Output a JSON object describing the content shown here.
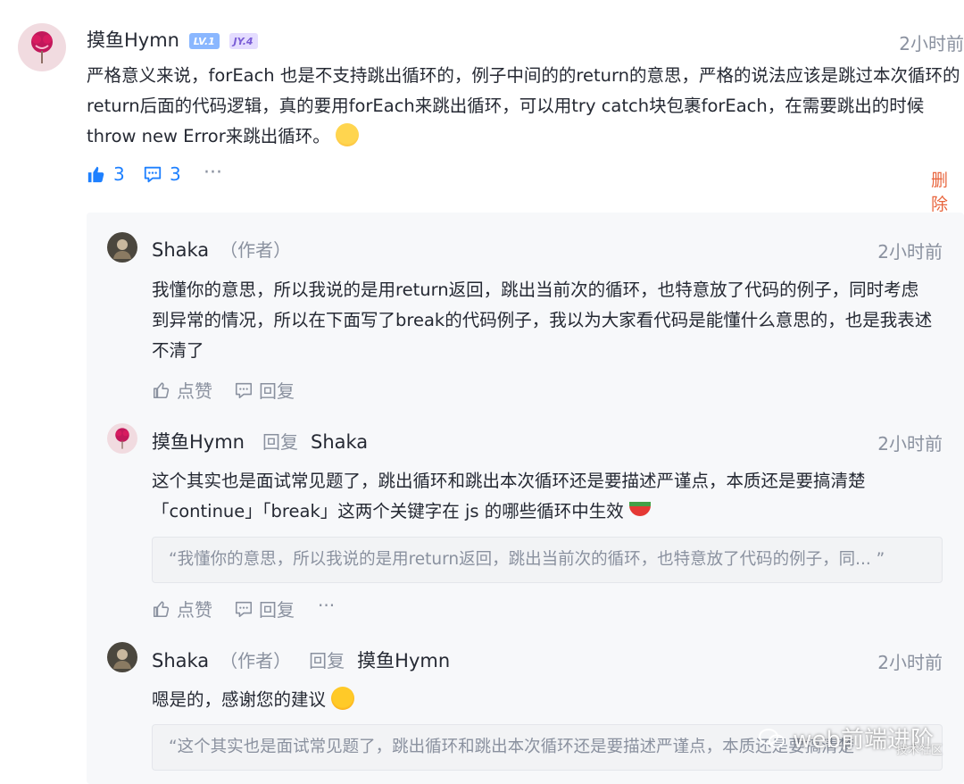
{
  "main_comment": {
    "author": "摸鱼Hymn",
    "badge_level": "LV.1",
    "badge_jy": "JY.4",
    "time": "2小时前",
    "line1": "严格意义来说，forEach 也是不支持跳出循环的，例子中间的的return的意思，严格的说法应该是跳过本次循环的",
    "line2": "return后面的代码逻辑，真的要用forEach来跳出循环，可以用try catch块包裹forEach，在需要跳出的时候",
    "line3": "throw new Error来跳出循环。",
    "like_count": "3",
    "comment_count": "3",
    "more": "···",
    "delete_label": "删除"
  },
  "replies": [
    {
      "author": "Shaka",
      "tag": "（作者）",
      "time": "2小时前",
      "line1": "我懂你的意思，所以我说的是用return返回，跳出当前次的循环，也特意放了代码的例子，同时考虑",
      "line2": "到异常的情况，所以在下面写了break的代码例子，我以为大家看代码是能懂什么意思的，也是我表述",
      "line3": "不清了",
      "like_label": "点赞",
      "reply_label": "回复"
    },
    {
      "author": "摸鱼Hymn",
      "reply_word": "回复",
      "reply_to": "Shaka",
      "time": "2小时前",
      "line1": "这个其实也是面试常见题了，跳出循环和跳出本次循环还是要描述严谨点，本质还是要搞清楚",
      "line2": "「continue」「break」这两个关键字在 js 的哪些循环中生效",
      "quote": "“我懂你的意思，所以我说的是用return返回，跳出当前次的循环，也特意放了代码的例子，同... ”",
      "like_label": "点赞",
      "reply_label": "回复",
      "more": "···"
    },
    {
      "author": "Shaka",
      "tag": "（作者）",
      "reply_word": "回复",
      "reply_to": "摸鱼Hymn",
      "time": "2小时前",
      "line1": "嗯是的，感谢您的建议",
      "quote": "“这个其实也是面试常见题了，跳出循环和跳出本次循环还是要描述严谨点，本质还是要搞清楚"
    }
  ],
  "watermark": {
    "title": "web前端进阶",
    "sub": "技术社区"
  },
  "colors": {
    "accent": "#1e80ff",
    "delete": "#e8643c",
    "muted": "#8a919f"
  }
}
